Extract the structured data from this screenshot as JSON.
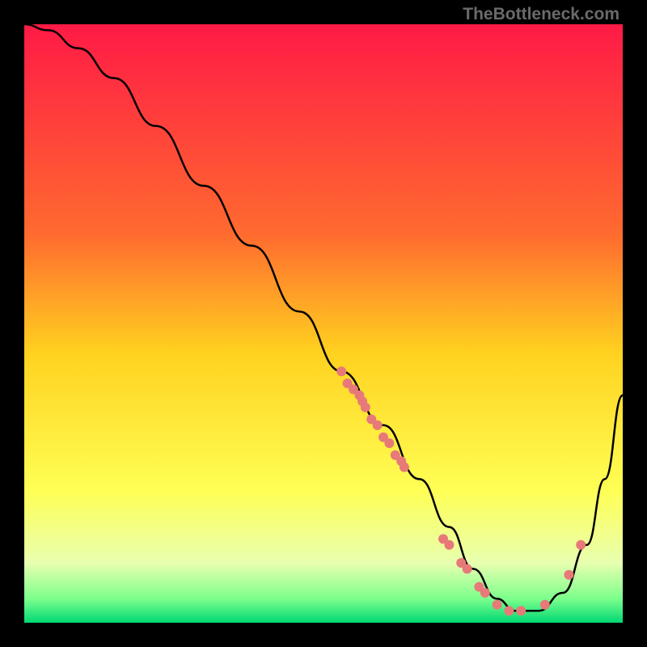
{
  "watermark": "TheBottleneck.com",
  "chart_data": {
    "type": "line",
    "title": "",
    "xlabel": "",
    "ylabel": "",
    "xlim": [
      0,
      100
    ],
    "ylim": [
      0,
      100
    ],
    "grid": false,
    "legend": false,
    "gradient_stops": [
      {
        "offset": 0,
        "color": "#ff1a46"
      },
      {
        "offset": 35,
        "color": "#ff6a2f"
      },
      {
        "offset": 55,
        "color": "#ffd21f"
      },
      {
        "offset": 78,
        "color": "#ffff55"
      },
      {
        "offset": 90,
        "color": "#e8ffb0"
      },
      {
        "offset": 96,
        "color": "#7cff8c"
      },
      {
        "offset": 100,
        "color": "#00d873"
      }
    ],
    "series": [
      {
        "name": "bottleneck-curve",
        "color": "#000000",
        "x": [
          0,
          4,
          9,
          15,
          22,
          30,
          38,
          46,
          53,
          60,
          66,
          71,
          75,
          79,
          82,
          86,
          90,
          94,
          97,
          100
        ],
        "y": [
          100,
          99,
          96,
          91,
          83,
          73,
          63,
          52,
          42,
          33,
          24,
          16,
          9,
          4,
          2,
          2,
          5,
          13,
          24,
          38
        ]
      }
    ],
    "scatter": [
      {
        "name": "data-points",
        "color": "#e77a78",
        "radius": 6,
        "x": [
          53,
          54,
          55,
          56,
          56.5,
          57,
          58,
          59,
          60,
          61,
          62,
          63,
          63.5,
          70,
          71,
          73,
          74,
          76,
          77,
          79,
          81,
          83,
          87,
          91,
          93
        ],
        "y": [
          42,
          40,
          39,
          38,
          37,
          36,
          34,
          33,
          31,
          30,
          28,
          27,
          26,
          14,
          13,
          10,
          9,
          6,
          5,
          3,
          2,
          2,
          3,
          8,
          13
        ]
      }
    ]
  }
}
